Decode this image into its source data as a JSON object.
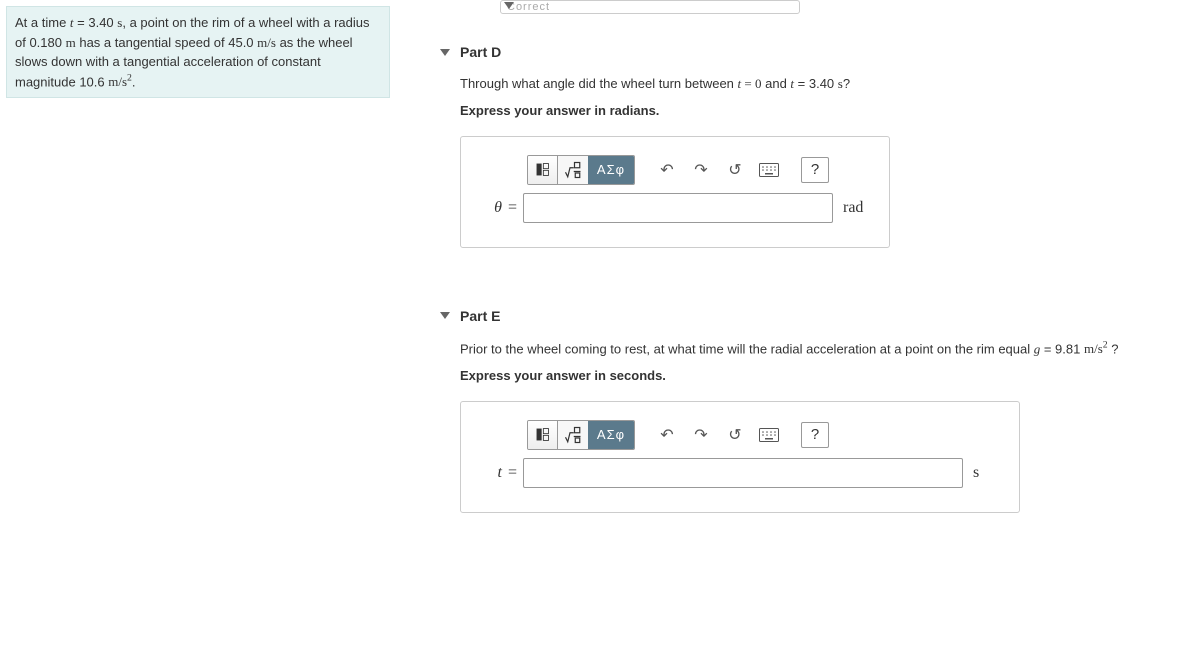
{
  "problem": {
    "pre1": "At a time ",
    "var_t": "t",
    "eq1": " = 3.40 ",
    "unit_s": "s",
    "mid1": ", a point on the rim of a wheel with a radius of 0.180 ",
    "unit_m": "m",
    "mid2": " has a tangential speed of 45.0 ",
    "unit_ms": "m/s",
    "mid3": " as the wheel slows down with a tangential acceleration of constant magnitude 10.6 ",
    "unit_ms2_base": "m/s",
    "unit_ms2_exp": "2",
    "end": "."
  },
  "prev": {
    "label": "Correct"
  },
  "parts": [
    {
      "title": "Part D",
      "q_pre": "Through what angle did the wheel turn between ",
      "q_t": "t",
      "q_eq": " = ",
      "q_mid1": "0",
      "q_mid2": " and ",
      "q_t2": "t",
      "q_eq2": " = 3.40 ",
      "q_unit": "s",
      "q_end": "?",
      "instruction": "Express your answer in radians.",
      "var": "θ",
      "unit": "rad"
    },
    {
      "title": "Part E",
      "q_pre": "Prior to the wheel coming to rest, at what time will the radial acceleration at a point on the rim equal ",
      "q_g": "g",
      "q_eq": " = 9.81 ",
      "q_unit": "m/s",
      "q_exp": "2",
      "q_end": " ?",
      "instruction": "Express your answer in seconds.",
      "var": "t",
      "unit": "s"
    }
  ],
  "toolbar": {
    "greek": "ΑΣφ",
    "help": "?"
  }
}
